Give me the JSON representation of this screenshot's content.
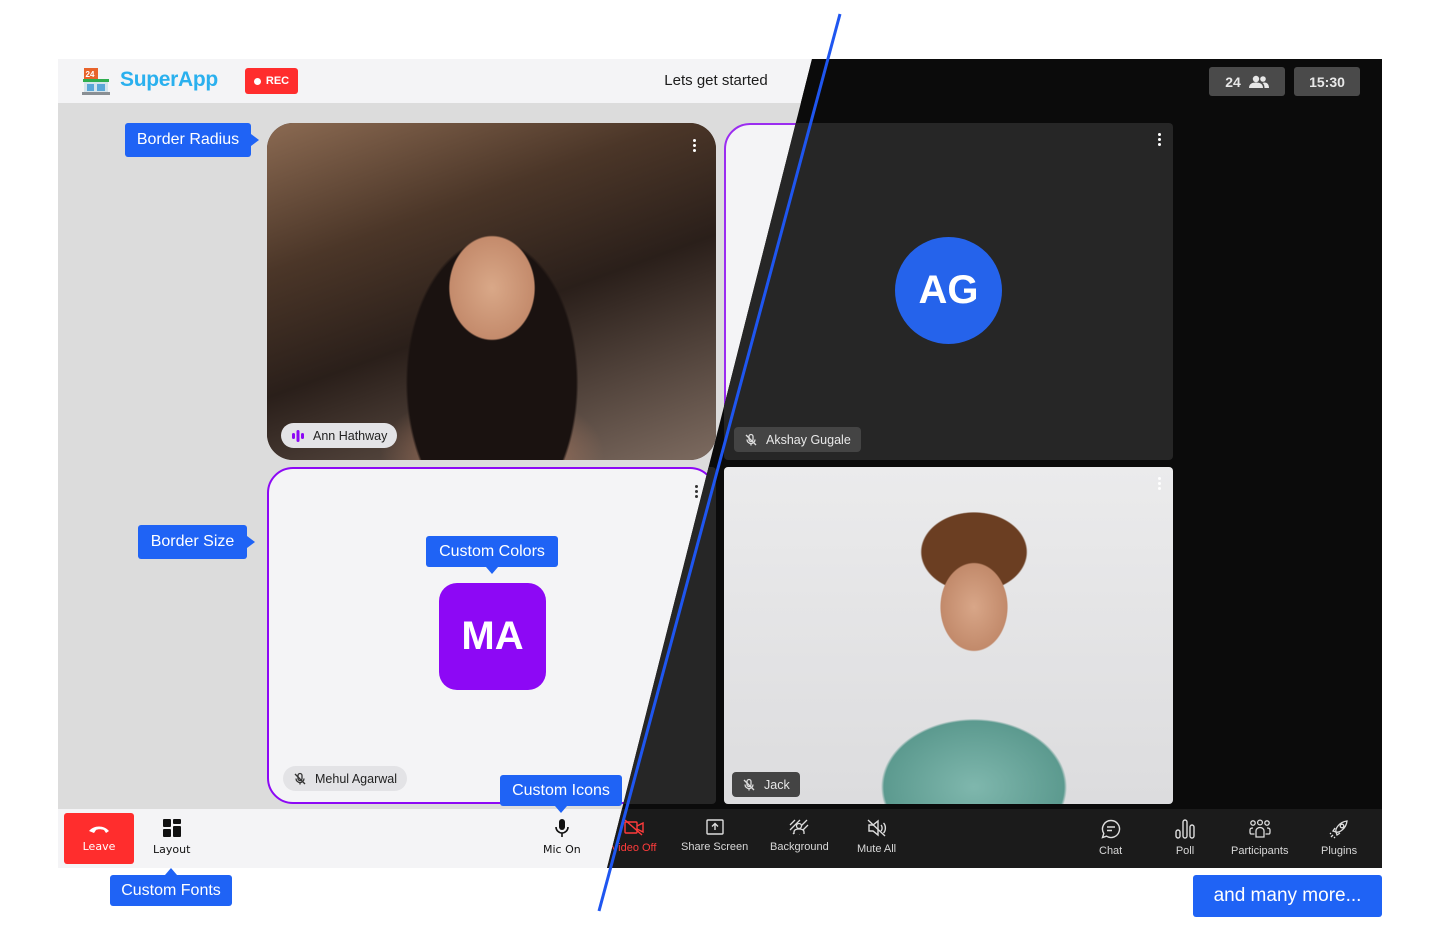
{
  "header": {
    "brand": "SuperApp",
    "rec_label": "REC",
    "meeting_title": "Lets get started",
    "participant_count": "24",
    "timer": "15:30"
  },
  "tiles": [
    {
      "name": "Ann Hathway",
      "state": "speaking",
      "video": true
    },
    {
      "name": "Akshay Gugale",
      "initials": "AG",
      "state": "muted",
      "video": false
    },
    {
      "name": "Mehul Agarwal",
      "initials": "MA",
      "state": "muted",
      "video": false
    },
    {
      "name": "Jack",
      "state": "muted",
      "video": true
    }
  ],
  "controls": {
    "leave": "Leave",
    "layout": "Layout",
    "mic": "Mic On",
    "video": "Video Off",
    "share": "Share Screen",
    "background": "Background",
    "mute_all": "Mute All",
    "chat": "Chat",
    "poll": "Poll",
    "participants": "Participants",
    "plugins": "Plugins"
  },
  "callouts": {
    "border_radius": "Border Radius",
    "border_size": "Border Size",
    "custom_colors": "Custom Colors",
    "custom_icons": "Custom Icons",
    "custom_fonts": "Custom Fonts",
    "many_more": "and many more..."
  },
  "colors": {
    "accent_blue": "#1f63f5",
    "rec_red": "#ff2d2d",
    "border_purple": "#8d08f5",
    "avatar_blue": "#2563eb"
  }
}
